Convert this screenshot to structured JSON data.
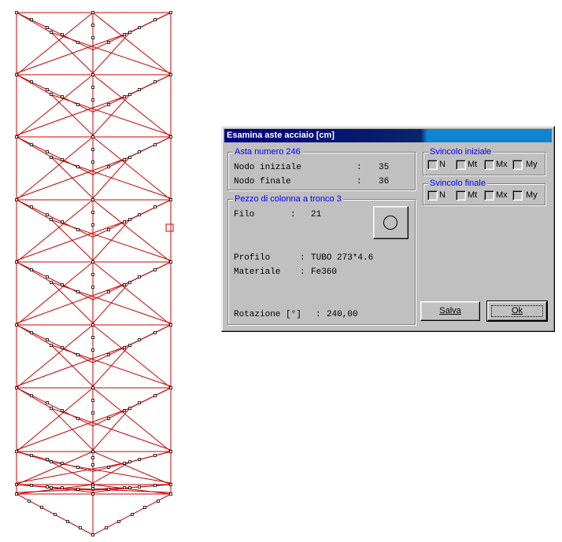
{
  "dialog": {
    "title": "Esamina aste acciaio [cm]",
    "asta_group": {
      "title": "Asta numero 246",
      "nodo_iniziale_label": "Nodo iniziale",
      "nodo_iniziale_value": "35",
      "nodo_finale_label": "Nodo finale",
      "nodo_finale_value": "36",
      "separator": ":"
    },
    "pezzo_group": {
      "title": "Pezzo di colonna a tronco 3",
      "filo_label": "Filo",
      "filo_value": "21",
      "profilo_label": "Profilo",
      "profilo_value": "TUBO 273*4.6",
      "materiale_label": "Materiale",
      "materiale_value": "Fe360",
      "rotazione_label": "Rotazione [°]",
      "rotazione_value": "240,00",
      "section_icon": "circle-section-icon"
    },
    "svincolo_iniziale": {
      "title": "Svincolo iniziale",
      "options": [
        "N",
        "Mt",
        "Mx",
        "My"
      ]
    },
    "svincolo_finale": {
      "title": "Svincolo finale",
      "options": [
        "N",
        "Mt",
        "Mx",
        "My"
      ]
    },
    "buttons": {
      "save": "Salva",
      "ok": "Ok"
    }
  },
  "colors": {
    "structure_line": "#cc0000",
    "group_title": "#0000ff",
    "title_bar": "#000080",
    "face": "#c0c0c0"
  }
}
